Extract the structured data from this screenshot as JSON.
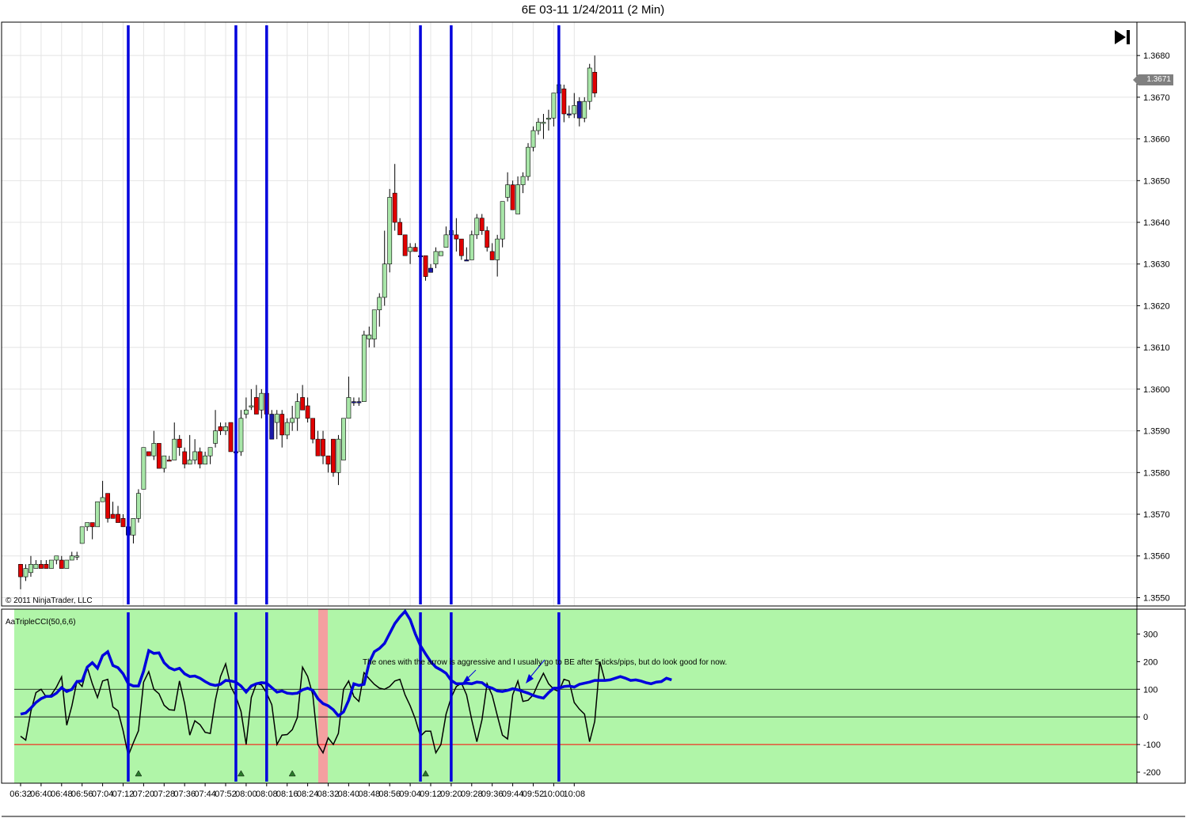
{
  "window": {
    "title": "6E 03-11  1/24/2011 (2 Min)",
    "copyright": "© 2011 NinjaTrader, LLC",
    "current_price_tag": "1.3671",
    "go_to_latest_icon": "skip-to-end-icon"
  },
  "colors": {
    "up_candle": "#a8e6a8",
    "down_candle": "#e00000",
    "signal_candle": "#1a1aa8",
    "signal_line": "#0000dd",
    "indicator_bg": "#b0f5a8",
    "cci_fast": "#000000",
    "cci_slow": "#0000dd",
    "upper_ref": "#000000",
    "lower_ref": "#ff0000",
    "highlight_bar": "#f4a0a0"
  },
  "indicator": {
    "label": "AaTripleCCI(50,6,6)",
    "annotation": "The ones with the arrow is aggressive and I usually go to BE after 5 ticks/pips, but do look good for now."
  },
  "chart_data": [
    {
      "type": "candlestick",
      "title": "6E 03-11  1/24/2011 (2 Min)",
      "ylim": [
        1.3548,
        1.3688
      ],
      "y_ticks": [
        "1.3550",
        "1.3560",
        "1.3570",
        "1.3580",
        "1.3590",
        "1.3600",
        "1.3610",
        "1.3620",
        "1.3630",
        "1.3640",
        "1.3650",
        "1.3660",
        "1.3670",
        "1.3680"
      ],
      "x_ticks": [
        "06:32",
        "06:40",
        "06:48",
        "06:56",
        "07:04",
        "07:12",
        "07:20",
        "07:28",
        "07:36",
        "07:44",
        "07:52",
        "08:00",
        "08:08",
        "08:16",
        "08:24",
        "08:32",
        "08:40",
        "08:48",
        "08:56",
        "09:04",
        "09:12",
        "09:20",
        "09:28",
        "09:36",
        "09:44",
        "09:52",
        "10:00",
        "10:08"
      ],
      "time_start": "06:32",
      "bar_minutes": 2,
      "signal_bar_times": [
        "07:14",
        "07:56",
        "08:08",
        "09:08",
        "09:20",
        "10:02"
      ],
      "candles": [
        [
          1.3558,
          1.3558,
          1.3552,
          1.3555,
          "d"
        ],
        [
          1.3555,
          1.3558,
          1.3554,
          1.3557,
          "u"
        ],
        [
          1.3556,
          1.356,
          1.3555,
          1.3558,
          "u"
        ],
        [
          1.3557,
          1.3559,
          1.3557,
          1.3558,
          "u"
        ],
        [
          1.3558,
          1.3559,
          1.3557,
          1.3557,
          "d"
        ],
        [
          1.3558,
          1.3559,
          1.3557,
          1.3557,
          "d"
        ],
        [
          1.3557,
          1.3559,
          1.3557,
          1.3559,
          "u"
        ],
        [
          1.3559,
          1.356,
          1.3558,
          1.356,
          "u"
        ],
        [
          1.3559,
          1.356,
          1.3557,
          1.3557,
          "d"
        ],
        [
          1.3557,
          1.3559,
          1.3557,
          1.3559,
          "u"
        ],
        [
          1.3559,
          1.3561,
          1.3559,
          1.356,
          "u"
        ],
        [
          1.356,
          1.3561,
          1.3559,
          1.356,
          "u"
        ],
        [
          1.3563,
          1.3567,
          1.3563,
          1.3567,
          "u"
        ],
        [
          1.3567,
          1.3568,
          1.3566,
          1.3568,
          "u"
        ],
        [
          1.3568,
          1.3568,
          1.3564,
          1.3567,
          "d"
        ],
        [
          1.3567,
          1.3573,
          1.3567,
          1.3573,
          "u"
        ],
        [
          1.3573,
          1.3578,
          1.3573,
          1.3574,
          "u"
        ],
        [
          1.3575,
          1.3575,
          1.3568,
          1.3569,
          "d"
        ],
        [
          1.357,
          1.3573,
          1.3569,
          1.3569,
          "d"
        ],
        [
          1.357,
          1.3572,
          1.3568,
          1.3568,
          "d"
        ],
        [
          1.3569,
          1.357,
          1.3567,
          1.3567,
          "d"
        ],
        [
          1.3567,
          1.3569,
          1.3565,
          1.3565,
          "s"
        ],
        [
          1.3565,
          1.3569,
          1.3563,
          1.3569,
          "u"
        ],
        [
          1.3569,
          1.3576,
          1.3568,
          1.3575,
          "u"
        ],
        [
          1.3576,
          1.3586,
          1.3576,
          1.3586,
          "u"
        ],
        [
          1.3585,
          1.3585,
          1.3584,
          1.3584,
          "d"
        ],
        [
          1.3584,
          1.359,
          1.3583,
          1.3587,
          "u"
        ],
        [
          1.3587,
          1.3587,
          1.3581,
          1.3581,
          "d"
        ],
        [
          1.3581,
          1.3584,
          1.358,
          1.3584,
          "u"
        ],
        [
          1.3583,
          1.3584,
          1.3583,
          1.3583,
          "d"
        ],
        [
          1.3583,
          1.3592,
          1.3583,
          1.3588,
          "u"
        ],
        [
          1.3588,
          1.3589,
          1.3584,
          1.3586,
          "d"
        ],
        [
          1.3585,
          1.3586,
          1.3581,
          1.3582,
          "d"
        ],
        [
          1.3582,
          1.3589,
          1.3582,
          1.3583,
          "u"
        ],
        [
          1.3583,
          1.3588,
          1.3582,
          1.3585,
          "u"
        ],
        [
          1.3585,
          1.3586,
          1.3581,
          1.3582,
          "d"
        ],
        [
          1.3582,
          1.3585,
          1.3582,
          1.3584,
          "u"
        ],
        [
          1.3584,
          1.3586,
          1.3582,
          1.3586,
          "u"
        ],
        [
          1.3587,
          1.3595,
          1.3586,
          1.359,
          "u"
        ],
        [
          1.3591,
          1.3592,
          1.3589,
          1.359,
          "d"
        ],
        [
          1.359,
          1.3592,
          1.3589,
          1.3591,
          "u"
        ],
        [
          1.3592,
          1.3592,
          1.3585,
          1.3585,
          "d"
        ],
        [
          1.3585,
          1.3585,
          1.3585,
          1.3585,
          "s"
        ],
        [
          1.3585,
          1.3595,
          1.3584,
          1.3593,
          "u"
        ],
        [
          1.3594,
          1.3598,
          1.3593,
          1.3595,
          "u"
        ],
        [
          1.3596,
          1.36,
          1.3595,
          1.3596,
          "u"
        ],
        [
          1.3598,
          1.3601,
          1.3594,
          1.3594,
          "d"
        ],
        [
          1.3595,
          1.36,
          1.3593,
          1.3599,
          "u"
        ],
        [
          1.3599,
          1.3599,
          1.3594,
          1.3594,
          "d"
        ],
        [
          1.3594,
          1.3595,
          1.3588,
          1.3588,
          "s"
        ],
        [
          1.3592,
          1.3595,
          1.3588,
          1.3594,
          "u"
        ],
        [
          1.3594,
          1.3595,
          1.3586,
          1.3589,
          "d"
        ],
        [
          1.3589,
          1.3593,
          1.3588,
          1.3592,
          "u"
        ],
        [
          1.3592,
          1.3596,
          1.359,
          1.3593,
          "u"
        ],
        [
          1.3593,
          1.3599,
          1.359,
          1.3597,
          "u"
        ],
        [
          1.3598,
          1.3601,
          1.3595,
          1.3595,
          "d"
        ],
        [
          1.3596,
          1.3598,
          1.3592,
          1.3593,
          "d"
        ],
        [
          1.3593,
          1.3593,
          1.3587,
          1.3588,
          "d"
        ],
        [
          1.3588,
          1.359,
          1.3584,
          1.3584,
          "d"
        ],
        [
          1.3588,
          1.359,
          1.3582,
          1.3584,
          "d"
        ],
        [
          1.3584,
          1.3584,
          1.358,
          1.3582,
          "d"
        ],
        [
          1.3588,
          1.3588,
          1.3579,
          1.358,
          "d"
        ],
        [
          1.358,
          1.3589,
          1.3577,
          1.3588,
          "u"
        ],
        [
          1.3583,
          1.3593,
          1.3583,
          1.3593,
          "u"
        ],
        [
          1.3593,
          1.3603,
          1.3593,
          1.3598,
          "u"
        ],
        [
          1.3597,
          1.3598,
          1.3596,
          1.3597,
          "s"
        ],
        [
          1.3597,
          1.3598,
          1.3596,
          1.3597,
          "s"
        ],
        [
          1.3597,
          1.3614,
          1.3597,
          1.3613,
          "u"
        ],
        [
          1.3613,
          1.3615,
          1.361,
          1.3612,
          "u"
        ],
        [
          1.3612,
          1.3619,
          1.361,
          1.3619,
          "u"
        ],
        [
          1.3619,
          1.3623,
          1.3615,
          1.3622,
          "u"
        ],
        [
          1.3622,
          1.3638,
          1.362,
          1.363,
          "u"
        ],
        [
          1.363,
          1.3648,
          1.3628,
          1.3646,
          "u"
        ],
        [
          1.3647,
          1.3654,
          1.3638,
          1.364,
          "d"
        ],
        [
          1.364,
          1.3641,
          1.3637,
          1.3637,
          "d"
        ],
        [
          1.3637,
          1.3637,
          1.3632,
          1.3632,
          "d"
        ],
        [
          1.3633,
          1.3635,
          1.363,
          1.3634,
          "u"
        ],
        [
          1.3634,
          1.3635,
          1.3633,
          1.3633,
          "d"
        ],
        [
          1.3632,
          1.3633,
          1.3632,
          1.3632,
          "s"
        ],
        [
          1.3632,
          1.3632,
          1.3626,
          1.3627,
          "d"
        ],
        [
          1.3629,
          1.363,
          1.3628,
          1.3628,
          "s"
        ],
        [
          1.363,
          1.3634,
          1.3629,
          1.3633,
          "u"
        ],
        [
          1.3632,
          1.3633,
          1.3632,
          1.3633,
          "u"
        ],
        [
          1.3634,
          1.3639,
          1.3634,
          1.3637,
          "u"
        ],
        [
          1.3638,
          1.3642,
          1.3637,
          1.3637,
          "u"
        ],
        [
          1.3637,
          1.3641,
          1.3633,
          1.3636,
          "d"
        ],
        [
          1.3636,
          1.3636,
          1.3631,
          1.3632,
          "d"
        ],
        [
          1.3631,
          1.3634,
          1.3631,
          1.3631,
          "s"
        ],
        [
          1.3631,
          1.3638,
          1.3631,
          1.3637,
          "u"
        ],
        [
          1.3637,
          1.3642,
          1.3636,
          1.3641,
          "u"
        ],
        [
          1.3641,
          1.3642,
          1.3637,
          1.3638,
          "d"
        ],
        [
          1.3638,
          1.3639,
          1.3633,
          1.3634,
          "d"
        ],
        [
          1.3633,
          1.3635,
          1.3631,
          1.3631,
          "d"
        ],
        [
          1.3631,
          1.3637,
          1.3627,
          1.3636,
          "u"
        ],
        [
          1.3636,
          1.3645,
          1.3634,
          1.3645,
          "u"
        ],
        [
          1.3646,
          1.3652,
          1.3645,
          1.3649,
          "u"
        ],
        [
          1.3649,
          1.365,
          1.3643,
          1.3643,
          "d"
        ],
        [
          1.3642,
          1.3651,
          1.3642,
          1.3649,
          "u"
        ],
        [
          1.3649,
          1.3652,
          1.3647,
          1.3651,
          "u"
        ],
        [
          1.3651,
          1.3659,
          1.365,
          1.3658,
          "u"
        ],
        [
          1.3658,
          1.3663,
          1.3657,
          1.3662,
          "u"
        ],
        [
          1.3662,
          1.3665,
          1.3661,
          1.3664,
          "u"
        ],
        [
          1.3664,
          1.3666,
          1.366,
          1.3664,
          "u"
        ],
        [
          1.3665,
          1.3667,
          1.3662,
          1.3665,
          "u"
        ],
        [
          1.3665,
          1.3671,
          1.3663,
          1.3671,
          "u"
        ],
        [
          1.3671,
          1.3675,
          1.367,
          1.3673,
          "u"
        ],
        [
          1.3672,
          1.3673,
          1.3664,
          1.3666,
          "d"
        ],
        [
          1.3666,
          1.3668,
          1.3665,
          1.3666,
          "s"
        ],
        [
          1.3666,
          1.3671,
          1.3665,
          1.3668,
          "u"
        ],
        [
          1.3669,
          1.367,
          1.3663,
          1.3665,
          "s"
        ],
        [
          1.3665,
          1.367,
          1.3664,
          1.3669,
          "u"
        ],
        [
          1.3669,
          1.3678,
          1.3667,
          1.3677,
          "u"
        ],
        [
          1.3676,
          1.368,
          1.367,
          1.3671,
          "d"
        ]
      ]
    },
    {
      "type": "line",
      "title": "AaTripleCCI(50,6,6)",
      "ylim": [
        -240,
        390
      ],
      "y_ticks": [
        300,
        200,
        100,
        0,
        -100,
        -200
      ],
      "reference_lines": [
        100,
        0,
        -100
      ],
      "highlight_time": "08:30",
      "triangle_times": [
        "07:18",
        "07:58",
        "08:18",
        "09:10"
      ],
      "series": [
        {
          "values": [
            10,
            14,
            32,
            52,
            66,
            74,
            74,
            86,
            106,
            92,
            100,
            128,
            130,
            180,
            196,
            176,
            222,
            236,
            186,
            178,
            156,
            120,
            112,
            112,
            166,
            240,
            230,
            232,
            196,
            178,
            170,
            176,
            156,
            146,
            148,
            140,
            128,
            118,
            114,
            118,
            132,
            130,
            126,
            112,
            90,
            112,
            120,
            124,
            122,
            106,
            90,
            94,
            86,
            84,
            86,
            98,
            104,
            96,
            66,
            48,
            40,
            26,
            4,
            18,
            60,
            120,
            114,
            118,
            196,
            236,
            248,
            266,
            302,
            338,
            362,
            382,
            352,
            300,
            258,
            228,
            200,
            180,
            170,
            158,
            132,
            120,
            120,
            122,
            120,
            126,
            124,
            110,
            104,
            94,
            92,
            96,
            102,
            98,
            92,
            86,
            78,
            72,
            68,
            88,
            104,
            104,
            110,
            112,
            108,
            118,
            122,
            126,
            132,
            132,
            132,
            134,
            140,
            146,
            140,
            132,
            134,
            130,
            124,
            120,
            126,
            128,
            140,
            134
          ]
        },
        {
          "values": [
            -70,
            -84,
            20,
            88,
            100,
            72,
            80,
            108,
            145,
            -30,
            40,
            130,
            110,
            180,
            120,
            70,
            130,
            136,
            36,
            22,
            -50,
            -140,
            -94,
            -50,
            126,
            164,
            100,
            84,
            42,
            26,
            24,
            130,
            48,
            -66,
            -14,
            -28,
            -56,
            -60,
            60,
            146,
            192,
            110,
            74,
            20,
            -100,
            70,
            120,
            116,
            86,
            44,
            -100,
            -66,
            -64,
            -46,
            -2,
            180,
            146,
            80,
            -100,
            -130,
            -76,
            -100,
            -60,
            100,
            130,
            74,
            56,
            160,
            138,
            118,
            104,
            100,
            110,
            130,
            136,
            80,
            40,
            -8,
            -70,
            -52,
            -52,
            -130,
            -100,
            10,
            70,
            110,
            122,
            80,
            -10,
            -90,
            -10,
            120,
            78,
            4,
            -66,
            -80,
            80,
            130,
            56,
            60,
            80,
            122,
            158,
            120,
            100,
            92,
            136,
            130,
            52,
            28,
            10,
            -90,
            -16,
            200,
            130
          ]
        }
      ]
    }
  ]
}
